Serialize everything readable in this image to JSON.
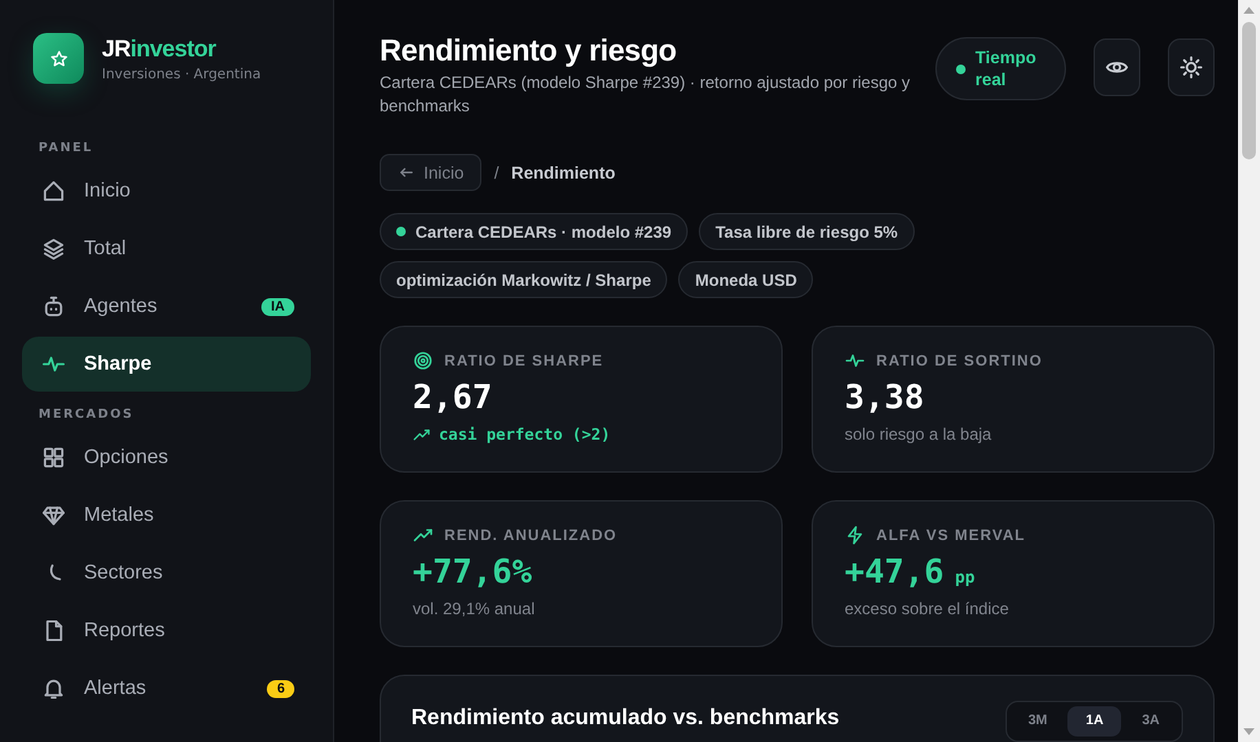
{
  "brand": {
    "name_prefix": "JR",
    "name_suffix": "investor",
    "subtitle": "Inversiones · Argentina"
  },
  "sidebar": {
    "sections": [
      {
        "title": "PANEL",
        "items": [
          {
            "label": "Inicio",
            "selected": false
          },
          {
            "label": "Total",
            "selected": false
          },
          {
            "label": "Agentes",
            "selected": false,
            "badge": {
              "text": "IA",
              "color": "#34d399"
            }
          },
          {
            "label": "Sharpe",
            "selected": true
          }
        ]
      },
      {
        "title": "MERCADOS",
        "items": [
          {
            "label": "Opciones",
            "selected": false
          },
          {
            "label": "Metales",
            "selected": false
          },
          {
            "label": "Sectores",
            "selected": false
          },
          {
            "label": "Reportes",
            "selected": false
          },
          {
            "label": "Alertas",
            "selected": false,
            "badge": {
              "text": "6",
              "color": "#facc15"
            }
          }
        ]
      }
    ]
  },
  "header": {
    "title": "Rendimiento y riesgo",
    "subtitle": "Cartera CEDEARs (modelo Sharpe #239) · retorno ajustado por riesgo y benchmarks",
    "live_badge": {
      "label": "Tiempo real",
      "on": true
    }
  },
  "breadcrumb": {
    "back": "Inicio",
    "separator": "/",
    "current": "Rendimiento"
  },
  "tags": [
    {
      "label": "Cartera CEDEARs · modelo #239",
      "dot": true
    },
    {
      "label": "Tasa libre de riesgo 5%",
      "dot": false
    },
    {
      "label": "optimización Markowitz / Sharpe",
      "dot": false
    },
    {
      "label": "Moneda USD",
      "dot": false
    }
  ],
  "stats": [
    {
      "label": "RATIO DE SHARPE",
      "value": "2,67",
      "positive": false,
      "note": "casi perfecto (>2)",
      "highlight": true
    },
    {
      "label": "RATIO DE SORTINO",
      "value": "3,38",
      "positive": false,
      "note": "solo riesgo a la baja",
      "highlight": false
    },
    {
      "label": "REND. ANUALIZADO",
      "value": "+77,6%",
      "positive": true,
      "note": "vol. 29,1% anual",
      "highlight": false
    },
    {
      "label": "ALFA VS MERVAL",
      "value": "+47,6",
      "unit": "pp",
      "positive": true,
      "note": "exceso sobre el índice",
      "highlight": false
    }
  ],
  "chart_card": {
    "title": "Rendimiento acumulado vs. benchmarks",
    "periods": [
      {
        "label": "3M",
        "selected": false
      },
      {
        "label": "1A",
        "selected": true
      },
      {
        "label": "3A",
        "selected": false
      }
    ]
  }
}
